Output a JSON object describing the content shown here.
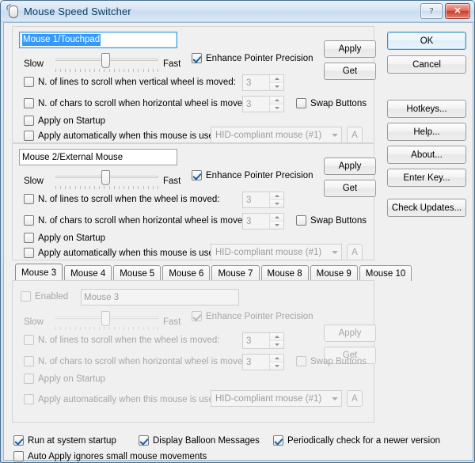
{
  "window": {
    "title": "Mouse Speed Switcher",
    "icon": "mouse-icon",
    "help_glyph": "?",
    "close_glyph": "✕"
  },
  "panels": [
    {
      "id": "mouse1",
      "name_value": "Mouse 1/Touchpad",
      "name_selected": true,
      "enabled": true,
      "slider": {
        "slow_label": "Slow",
        "fast_label": "Fast",
        "position_percent": 48,
        "ticks": 22
      },
      "enhance_label": "Enhance Pointer Precision",
      "enhance_checked": true,
      "apply_label": "Apply",
      "get_label": "Get",
      "vlines_label": "N. of lines to scroll when vertical wheel is moved:",
      "vlines_checked": false,
      "vlines_value": "3",
      "hchars_label": "N. of chars to scroll when  horizontal wheel is moved:",
      "hchars_checked": false,
      "hchars_value": "3",
      "swap_label": "Swap Buttons",
      "swap_checked": false,
      "startup_label": "Apply on Startup",
      "startup_checked": false,
      "auto_label": "Apply automatically when this mouse is used:",
      "auto_checked": false,
      "device_value": "HID-compliant mouse (#1)",
      "a_label": "A"
    },
    {
      "id": "mouse2",
      "name_value": "Mouse 2/External Mouse",
      "name_selected": false,
      "enabled": true,
      "slider": {
        "slow_label": "Slow",
        "fast_label": "Fast",
        "position_percent": 48,
        "ticks": 22
      },
      "enhance_label": "Enhance Pointer Precision",
      "enhance_checked": true,
      "apply_label": "Apply",
      "get_label": "Get",
      "vlines_label": "N. of lines to scroll when the wheel is moved:",
      "vlines_checked": false,
      "vlines_value": "3",
      "hchars_label": "N. of chars to scroll when  horizontal wheel is moved:",
      "hchars_checked": false,
      "hchars_value": "3",
      "swap_label": "Swap Buttons",
      "swap_checked": false,
      "startup_label": "Apply on Startup",
      "startup_checked": false,
      "auto_label": "Apply automatically when this mouse is used:",
      "auto_checked": false,
      "device_value": "HID-compliant mouse (#1)",
      "a_label": "A"
    },
    {
      "id": "mouse3",
      "tabs": [
        "Mouse 3",
        "Mouse 4",
        "Mouse 5",
        "Mouse 6",
        "Mouse 7",
        "Mouse 8",
        "Mouse 9",
        "Mouse  10"
      ],
      "active_tab": 0,
      "enabled_label": "Enabled",
      "enabled_checked": false,
      "name_value": "Mouse 3",
      "enabled": false,
      "slider": {
        "slow_label": "Slow",
        "fast_label": "Fast",
        "position_percent": 48,
        "ticks": 22
      },
      "enhance_label": "Enhance Pointer Precision",
      "enhance_checked": true,
      "apply_label": "Apply",
      "get_label": "Get",
      "vlines_label": "N. of lines to scroll when the wheel is moved:",
      "vlines_checked": false,
      "vlines_value": "3",
      "hchars_label": "N. of chars to scroll when  horizontal wheel is moved:",
      "hchars_checked": false,
      "hchars_value": "3",
      "swap_label": "Swap Buttons",
      "swap_checked": false,
      "startup_label": "Apply on Startup",
      "startup_checked": false,
      "auto_label": "Apply automatically when this mouse is used:",
      "auto_checked": false,
      "device_value": "HID-compliant mouse (#1)",
      "a_label": "A"
    }
  ],
  "side_buttons": {
    "ok": "OK",
    "cancel": "Cancel",
    "hotkeys": "Hotkeys...",
    "help": "Help...",
    "about": "About...",
    "enter_key": "Enter Key...",
    "check_updates": "Check Updates..."
  },
  "footer": {
    "run_startup_label": "Run at system startup",
    "run_startup_checked": true,
    "balloon_label": "Display Balloon Messages",
    "balloon_checked": true,
    "periodic_label": "Periodically check for a newer version",
    "periodic_checked": true,
    "autoapply_label": "Auto Apply ignores small mouse movements",
    "autoapply_checked": false
  }
}
